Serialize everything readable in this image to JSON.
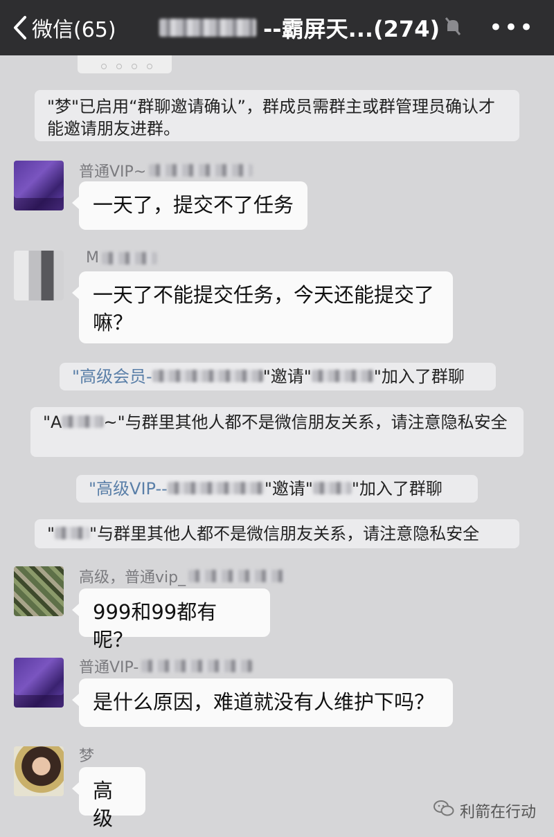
{
  "header": {
    "back_label": "微信(65)",
    "title": "--霸屏天...(274)",
    "more_label": "•••"
  },
  "notices": [
    {
      "text": "\"梦\"已启用“群聊邀请确认”，群成员需群主或群管理员确认才能邀请朋友进群。"
    },
    {
      "text": "\"高级会员-",
      "text2": "\"邀请\"",
      "text3": "\"加入了群聊"
    },
    {
      "text": "\"A",
      "text2": "~\"与群里其他人都不是微信朋友关系，请注意隐私安全"
    },
    {
      "text": "\"高级VIP--",
      "text2": "\"邀请\"",
      "text3": "\"加入了群聊"
    },
    {
      "text": "\"",
      "text2": "\"与群里其他人都不是微信朋友关系，请注意隐私安全"
    }
  ],
  "messages": [
    {
      "name": "普通VIP~",
      "text": "一天了，提交不了任务"
    },
    {
      "name": "M",
      "text": "一天了不能提交任务，今天还能提交了嘛？"
    },
    {
      "name": "高级，普通vip_",
      "text": "999和99都有呢？"
    },
    {
      "name": "普通VIP-",
      "text": "是什么原因，难道就没有人维护下吗？"
    },
    {
      "name": "梦",
      "text": "高级"
    }
  ],
  "watermark": {
    "text": "利箭在行动",
    "icon": "wechat-icon"
  },
  "colors": {
    "header_bg": "#2e2e30",
    "chat_bg": "#d6d6d8",
    "bubble_bg": "#fafafa",
    "notice_bg": "#ebebed",
    "link_blue": "#5a7fa8"
  }
}
